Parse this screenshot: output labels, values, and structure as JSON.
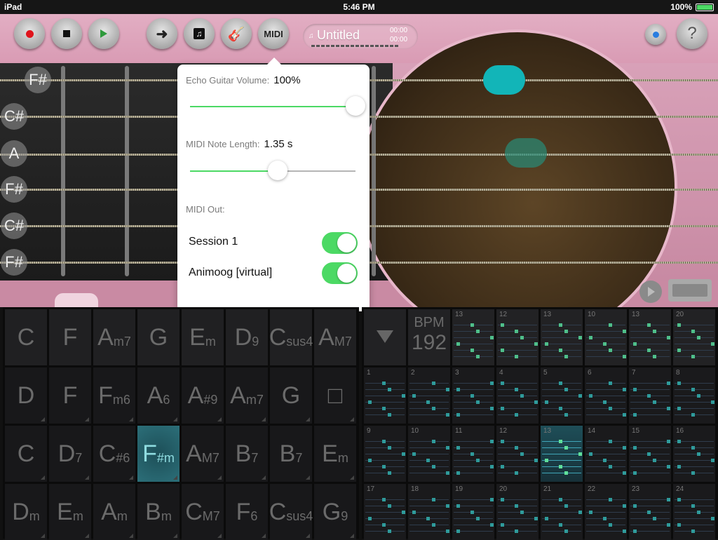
{
  "status": {
    "device": "iPad",
    "time": "5:46 PM",
    "battery": "100%"
  },
  "toolbar": {
    "record": "record",
    "stop": "stop",
    "play": "play",
    "next": "next",
    "song": "song",
    "guitar": "guitar",
    "midi_label": "MIDI",
    "help": "?"
  },
  "song": {
    "title": "Untitled",
    "rec_time": "00:00",
    "play_time": "00:00"
  },
  "strings": [
    "F#",
    "C#",
    "A",
    "F#",
    "C#",
    "F#"
  ],
  "popover": {
    "volume_label": "Echo Guitar Volume:",
    "volume_value": "100%",
    "volume_fraction": 1.0,
    "note_label": "MIDI Note Length:",
    "note_value": "1.35 s",
    "note_fraction": 0.53,
    "midi_out_label": "MIDI Out:",
    "outputs": [
      {
        "name": "Session 1",
        "on": true
      },
      {
        "name": "Animoog [virtual]",
        "on": true
      }
    ]
  },
  "chords": [
    [
      [
        "C",
        ""
      ],
      [
        "F",
        ""
      ],
      [
        "A",
        "m7"
      ],
      [
        "G",
        ""
      ],
      [
        "E",
        "m"
      ],
      [
        "D",
        "9"
      ],
      [
        "C",
        "sus4"
      ],
      [
        "A",
        "M7"
      ]
    ],
    [
      [
        "D",
        ""
      ],
      [
        "F",
        ""
      ],
      [
        "F",
        "m6"
      ],
      [
        "A",
        "6"
      ],
      [
        "A",
        "#9"
      ],
      [
        "A",
        "m7"
      ],
      [
        "G",
        ""
      ],
      [
        "□",
        ""
      ]
    ],
    [
      [
        "C",
        ""
      ],
      [
        "D",
        "7"
      ],
      [
        "C",
        "#6"
      ],
      [
        "F",
        "#m"
      ],
      [
        "A",
        "M7"
      ],
      [
        "B",
        "7"
      ],
      [
        "B",
        "7"
      ],
      [
        "E",
        "m"
      ]
    ],
    [
      [
        "D",
        "m"
      ],
      [
        "E",
        "m"
      ],
      [
        "A",
        "m"
      ],
      [
        "B",
        "m"
      ],
      [
        "C",
        "M7"
      ],
      [
        "F",
        "6"
      ],
      [
        "C",
        "sus4"
      ],
      [
        "G",
        "9"
      ]
    ]
  ],
  "active_chord": [
    2,
    3
  ],
  "bpm": {
    "label": "BPM",
    "value": "192"
  },
  "top_patterns": [
    "13",
    "12",
    "13",
    "10",
    "13",
    "20"
  ],
  "patterns": [
    "1",
    "2",
    "3",
    "4",
    "5",
    "6",
    "7",
    "8",
    "9",
    "10",
    "11",
    "12",
    "13",
    "14",
    "15",
    "16",
    "17",
    "18",
    "19",
    "20",
    "21",
    "22",
    "23",
    "24"
  ],
  "active_pattern": "13"
}
